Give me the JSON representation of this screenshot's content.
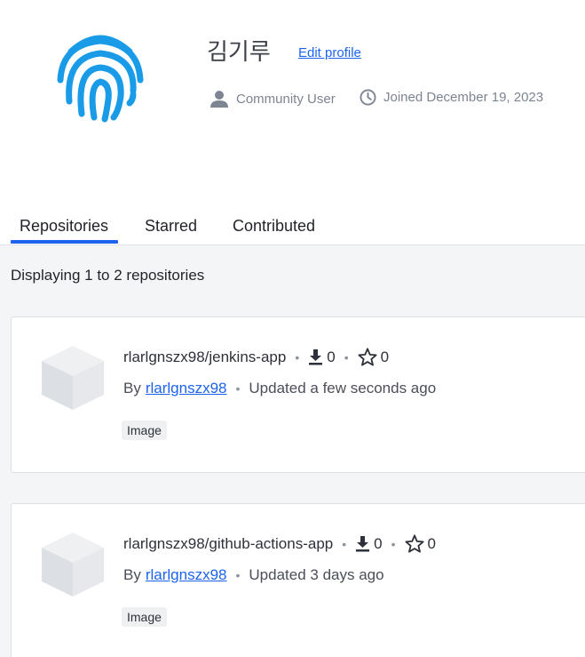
{
  "profile": {
    "name": "김기루",
    "edit_label": "Edit profile",
    "role": "Community User",
    "joined": "Joined December 19, 2023"
  },
  "tabs": [
    {
      "label": "Repositories",
      "active": true
    },
    {
      "label": "Starred",
      "active": false
    },
    {
      "label": "Contributed",
      "active": false
    }
  ],
  "listing": {
    "count_text": "Displaying 1 to 2 repositories"
  },
  "repositories": [
    {
      "name": "rlarlgnszx98/jenkins-app",
      "downloads": "0",
      "stars": "0",
      "by_label": "By",
      "owner": "rlarlgnszx98",
      "updated": "Updated a few seconds ago",
      "badge": "Image"
    },
    {
      "name": "rlarlgnszx98/github-actions-app",
      "downloads": "0",
      "stars": "0",
      "by_label": "By",
      "owner": "rlarlgnszx98",
      "updated": "Updated 3 days ago",
      "badge": "Image"
    }
  ],
  "colors": {
    "accent": "#1d63ed",
    "fingerprint": "#1a9be8",
    "background": "#f4f5f6"
  },
  "icons": {
    "avatar": "fingerprint-icon",
    "role": "user-icon",
    "joined": "clock-icon",
    "repo": "cube-icon",
    "downloads": "download-icon",
    "stars": "star-icon"
  }
}
